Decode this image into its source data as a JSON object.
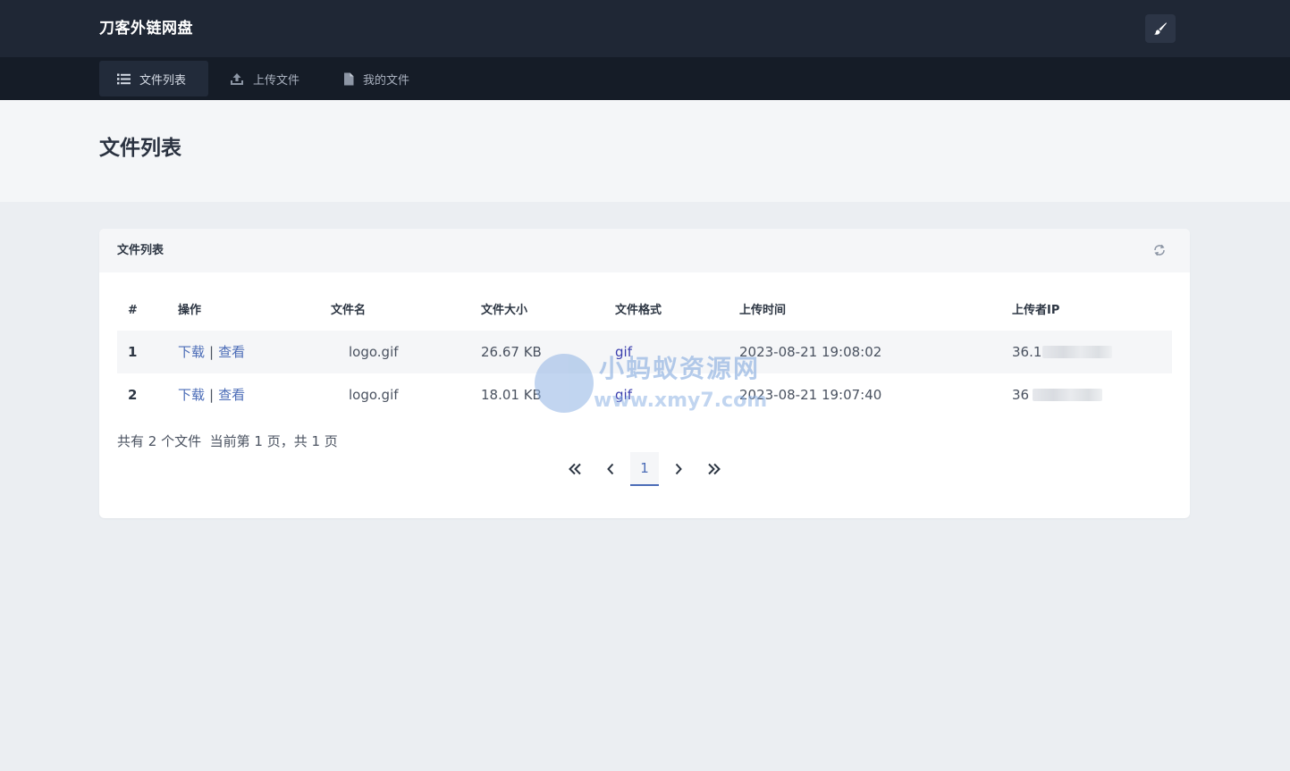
{
  "header": {
    "brand": "刀客外链网盘"
  },
  "nav": {
    "items": [
      {
        "label": "文件列表",
        "icon": "list-icon",
        "active": true
      },
      {
        "label": "上传文件",
        "icon": "upload-icon",
        "active": false
      },
      {
        "label": "我的文件",
        "icon": "file-icon",
        "active": false
      }
    ]
  },
  "page": {
    "title": "文件列表"
  },
  "card": {
    "title": "文件列表",
    "columns": [
      "#",
      "操作",
      "文件名",
      "文件大小",
      "文件格式",
      "上传时间",
      "上传者IP"
    ],
    "rows": [
      {
        "idx": "1",
        "download": "下载",
        "sep": "|",
        "view": "查看",
        "name": "logo.gif",
        "size": "26.67 KB",
        "format": "gif",
        "time": "2023-08-21 19:08:02",
        "ip": "36.1"
      },
      {
        "idx": "2",
        "download": "下载",
        "sep": "|",
        "view": "查看",
        "name": "logo.gif",
        "size": "18.01 KB",
        "format": "gif",
        "time": "2023-08-21 19:07:40",
        "ip": "36"
      }
    ],
    "summary": "共有 2 个文件  当前第 1 页，共 1 页",
    "pager": {
      "current": "1"
    }
  },
  "watermark": {
    "line1": "小蚂蚁资源网",
    "line2": "www.xmy7.com"
  },
  "colors": {
    "topbar": "#1f2735",
    "navbar": "#151c27",
    "link": "#4b6cb7",
    "format": "#3b3fae",
    "background": "#ebeef2"
  }
}
